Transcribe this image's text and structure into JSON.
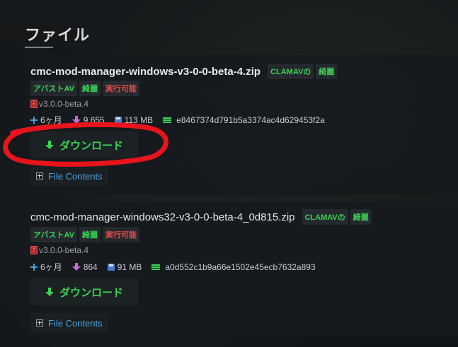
{
  "section_title": "ファイル",
  "files": [
    {
      "filename": "cmc-mod-manager-windows-v3-0-0-beta-4.zip",
      "clamav_label": "CLAMAVの",
      "clamav_status": "綺麗",
      "avast_label": "アバストAV",
      "avast_status": "綺麗",
      "exec_label": "実行可能",
      "version": "v3.0.0-beta.4",
      "age": "6ヶ月",
      "downloads": "9,655",
      "size": "113 MB",
      "hash": "e8467374d791b5a3374ac4d629453f2a",
      "download_label": "ダウンロード",
      "file_contents_label": "File Contents"
    },
    {
      "filename": "cmc-mod-manager-windows32-v3-0-0-beta-4_0d815.zip",
      "clamav_label": "CLAMAVの",
      "clamav_status": "綺麗",
      "avast_label": "アバストAV",
      "avast_status": "綺麗",
      "exec_label": "実行可能",
      "version": "v3.0.0-beta.4",
      "age": "6ヶ月",
      "downloads": "864",
      "size": "91 MB",
      "hash": "a0d552c1b9a66e1502e45ecb7632a893",
      "download_label": "ダウンロード",
      "file_contents_label": "File Contents"
    }
  ],
  "colors": {
    "accent_green": "#39d353",
    "exec_red": "#e74c4c",
    "link_blue": "#4aa3df",
    "annotation_red": "#e8141c"
  },
  "icons": {
    "version": "archive-icon",
    "age": "plus-icon",
    "downloads": "download-arrow-icon",
    "size": "disk-icon",
    "hash": "hash-lines-icon",
    "download_button": "arrow-down-icon",
    "file_contents": "expand-box-icon"
  }
}
